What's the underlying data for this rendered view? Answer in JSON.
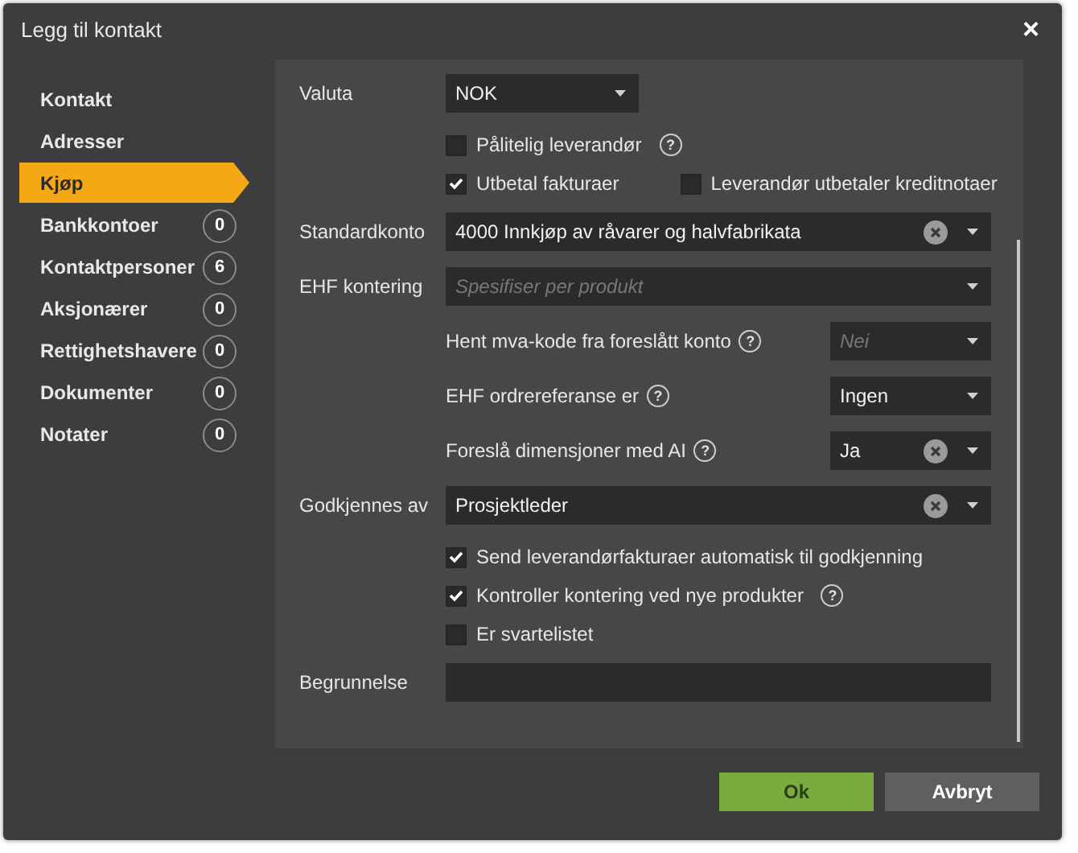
{
  "window": {
    "title": "Legg til kontakt",
    "close": "×"
  },
  "sidebar": {
    "items": [
      {
        "label": "Kontakt",
        "selected": false
      },
      {
        "label": "Adresser",
        "selected": false
      },
      {
        "label": "Kjøp",
        "selected": true
      },
      {
        "label": "Bankkontoer",
        "badge": "0",
        "selected": false
      },
      {
        "label": "Kontaktpersoner",
        "badge": "6",
        "selected": false
      },
      {
        "label": "Aksjonærer",
        "badge": "0",
        "selected": false
      },
      {
        "label": "Rettighetshavere",
        "badge": "0",
        "selected": false
      },
      {
        "label": "Dokumenter",
        "badge": "0",
        "selected": false
      },
      {
        "label": "Notater",
        "badge": "0",
        "selected": false
      }
    ]
  },
  "form": {
    "fields": [
      {
        "kind": "short-select",
        "label": "Valuta",
        "value": "NOK",
        "clearable": false
      },
      {
        "kind": "checks",
        "items": [
          {
            "label": "Pålitelig leverandør",
            "checked": false,
            "help": "?"
          }
        ]
      },
      {
        "kind": "checks",
        "items": [
          {
            "label": "Utbetal fakturaer",
            "checked": true
          },
          {
            "label": "Leverandør utbetaler kreditnotaer",
            "checked": false
          }
        ]
      },
      {
        "kind": "select",
        "label": "Standardkonto",
        "value": "4000 Innkjøp av råvarer og halvfabrikata",
        "clearable": true
      },
      {
        "kind": "select",
        "label": "EHF kontering",
        "placeholder": "Spesifiser per produkt",
        "clearable": false
      },
      {
        "kind": "sub-select",
        "label": "Hent mva-kode fra foreslått konto",
        "help": "?",
        "placeholder": "Nei",
        "clearable": false
      },
      {
        "kind": "sub-select",
        "label": "EHF ordrereferanse er",
        "help": "?",
        "value": "Ingen",
        "clearable": false
      },
      {
        "kind": "sub-select",
        "label": "Foreslå dimensjoner med AI",
        "help": "?",
        "value": "Ja",
        "clearable": true
      },
      {
        "kind": "select",
        "label": "Godkjennes av",
        "value": "Prosjektleder",
        "clearable": true
      },
      {
        "kind": "checks",
        "items": [
          {
            "label": "Send leverandørfakturaer automatisk til godkjenning",
            "checked": true
          }
        ]
      },
      {
        "kind": "checks",
        "items": [
          {
            "label": "Kontroller kontering ved nye produkter",
            "checked": true,
            "help": "?"
          }
        ]
      },
      {
        "kind": "checks",
        "items": [
          {
            "label": "Er svartelistet",
            "checked": false
          }
        ]
      },
      {
        "kind": "text",
        "label": "Begrunnelse"
      }
    ]
  },
  "buttons": [
    {
      "label": "Ok",
      "kind": "primary"
    },
    {
      "label": "Avbryt",
      "kind": "secondary"
    }
  ]
}
